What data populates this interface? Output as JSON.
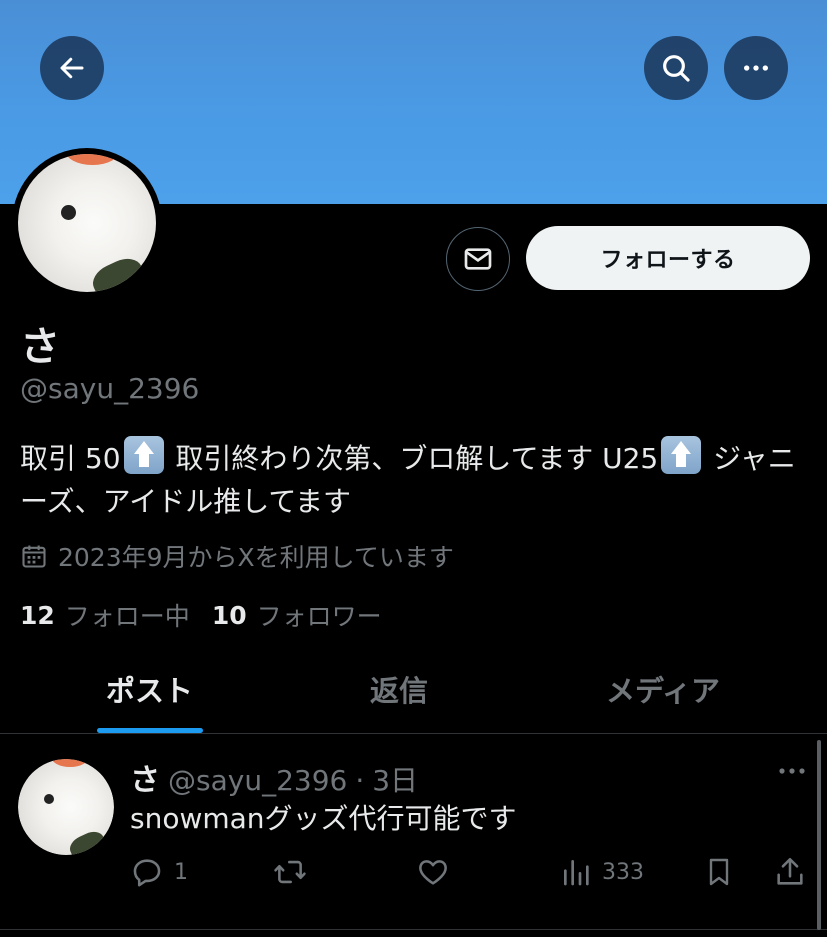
{
  "profile": {
    "display_name": "さ",
    "handle": "@sayu_2396",
    "bio_part1": "取引 50",
    "bio_part2": " 取引終わり次第、ブロ解してます U25",
    "bio_part3": " ジャニーズ、アイドル推してます",
    "joined": "2023年9月からXを利用しています",
    "following_count": "12",
    "following_label": "フォロー中",
    "followers_count": "10",
    "followers_label": "フォロワー"
  },
  "header": {
    "back_icon": "arrow-left-icon",
    "search_icon": "search-icon",
    "more_icon": "more-horizontal-icon",
    "banner_color": "#4a9be6"
  },
  "actions": {
    "follow_label": "フォローする",
    "message_icon": "mail-icon"
  },
  "tabs": [
    {
      "label": "ポスト",
      "active": true
    },
    {
      "label": "返信",
      "active": false
    },
    {
      "label": "メディア",
      "active": false
    }
  ],
  "accent_color": "#1d9bf0",
  "post": {
    "name": "さ",
    "handle": "@sayu_2396",
    "separator": "·",
    "time": "3日",
    "text": "snowmanグッズ代行可能です",
    "reply_count": "1",
    "views": "333"
  }
}
